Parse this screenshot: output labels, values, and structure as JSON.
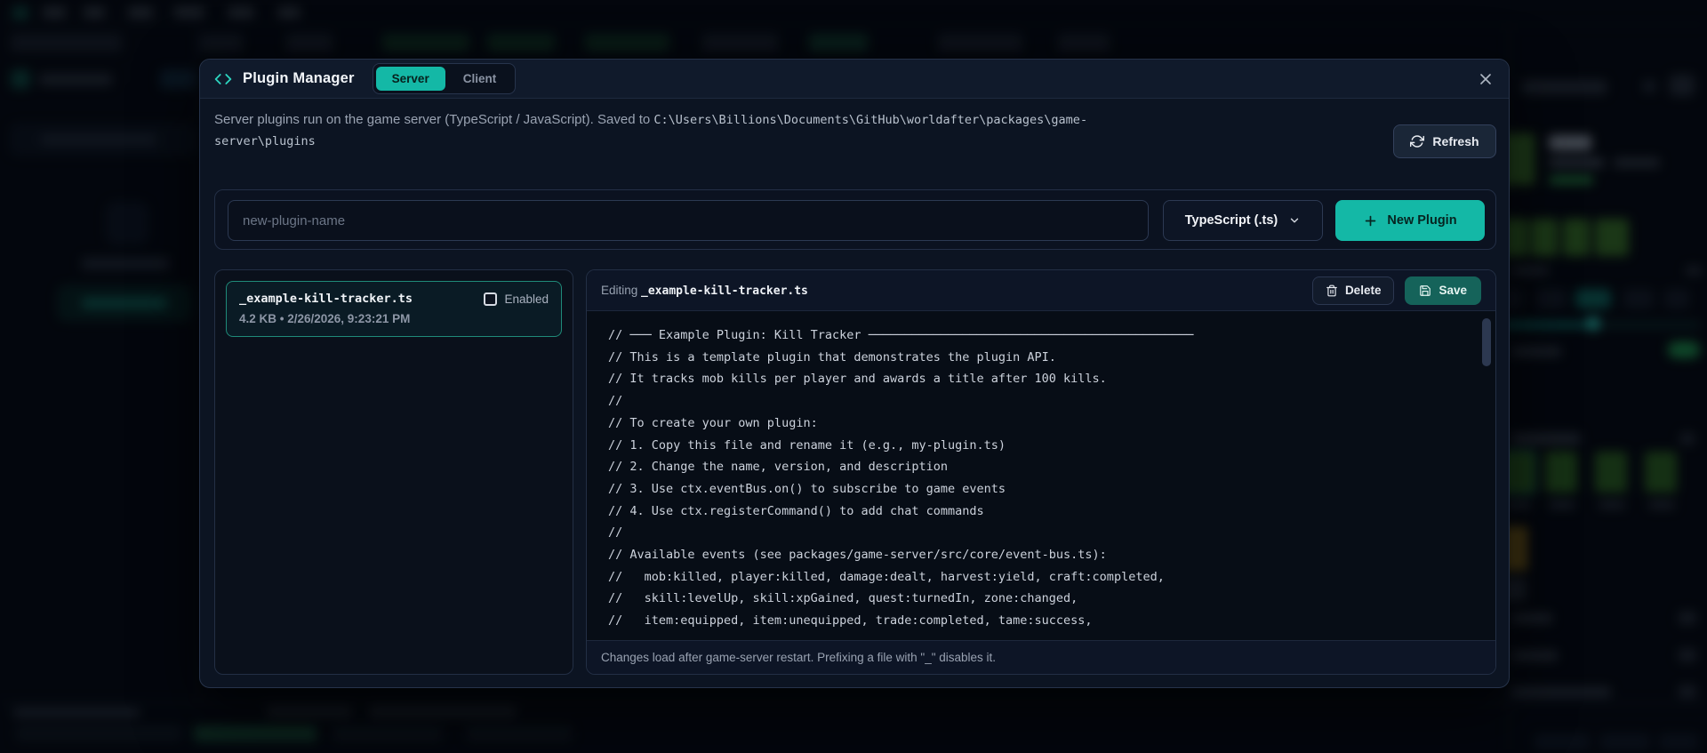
{
  "colors": {
    "accent_teal": "#14b8a6",
    "accent_teal_bright": "#2dd4bf",
    "save_button_bg": "#15635a",
    "modal_bg": "#0c1422",
    "code_bg": "#070d16",
    "bg_green": "#3c7a24",
    "bg_yellow": "#8a6a14"
  },
  "modal": {
    "title": "Plugin Manager",
    "tabs": [
      {
        "label": "Server",
        "active": true
      },
      {
        "label": "Client",
        "active": false
      }
    ],
    "description": {
      "text": "Server plugins run on the game server (TypeScript / JavaScript). Saved to ",
      "path": "C:\\Users\\Billions\\Documents\\GitHub\\worldafter\\packages\\game-server\\plugins"
    },
    "refresh_label": "Refresh",
    "new_plugin": {
      "name_placeholder": "new-plugin-name",
      "language_selected": "TypeScript (.ts)",
      "create_label": "New Plugin"
    },
    "plugin_list": [
      {
        "filename": "_example-kill-tracker.ts",
        "enabled_label": "Enabled",
        "enabled": false,
        "meta": "4.2 KB • 2/26/2026, 9:23:21 PM",
        "selected": true
      }
    ],
    "editor": {
      "editing_prefix": "Editing ",
      "editing_filename": "_example-kill-tracker.ts",
      "delete_label": "Delete",
      "save_label": "Save",
      "code_lines": [
        "// ─── Example Plugin: Kill Tracker ─────────────────────────────────────────────",
        "// This is a template plugin that demonstrates the plugin API.",
        "// It tracks mob kills per player and awards a title after 100 kills.",
        "//",
        "// To create your own plugin:",
        "// 1. Copy this file and rename it (e.g., my-plugin.ts)",
        "// 2. Change the name, version, and description",
        "// 3. Use ctx.eventBus.on() to subscribe to game events",
        "// 4. Use ctx.registerCommand() to add chat commands",
        "//",
        "// Available events (see packages/game-server/src/core/event-bus.ts):",
        "//   mob:killed, player:killed, damage:dealt, harvest:yield, craft:completed,",
        "//   skill:levelUp, skill:xpGained, quest:turnedIn, zone:changed,",
        "//   item:equipped, item:unequipped, trade:completed, tame:success,"
      ],
      "footer_note": "Changes load after game-server restart. Prefixing a file with \"_\" disables it."
    }
  }
}
